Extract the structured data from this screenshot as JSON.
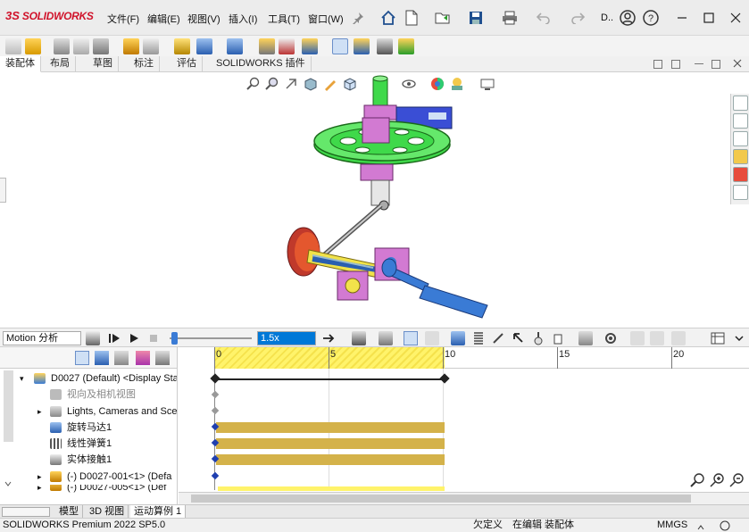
{
  "app": {
    "logo_ds": "3S",
    "logo_text": "SOLIDWORKS",
    "search_trunc": "D.."
  },
  "menu": {
    "items": [
      "文件(F)",
      "编辑(E)",
      "视图(V)",
      "插入(I)",
      "工具(T)",
      "窗口(W)"
    ]
  },
  "tabs": {
    "items": [
      "装配体",
      "布局",
      "草图",
      "标注",
      "评估",
      "SOLIDWORKS 插件"
    ]
  },
  "motion": {
    "study_type": "Motion 分析",
    "speed": "1.5x"
  },
  "timeline": {
    "ticks": [
      "0",
      "5",
      "10",
      "15",
      "20"
    ]
  },
  "tree": {
    "nodes": [
      {
        "label": "D0027 (Default) <Display Sta"
      },
      {
        "label": "视向及相机视图"
      },
      {
        "label": "Lights, Cameras and Sce"
      },
      {
        "label": "旋转马达1"
      },
      {
        "label": "线性弹簧1"
      },
      {
        "label": "实体接触1"
      },
      {
        "label": "(-) D0027-001<1> (Defa"
      },
      {
        "label": "(-) D0027-005<1> (Def"
      }
    ]
  },
  "bottom_tabs": {
    "items": [
      "模型",
      "3D 视图",
      "运动算例 1"
    ]
  },
  "status": {
    "product": "SOLIDWORKS Premium 2022 SP5.0",
    "custom": "欠定义",
    "editing": "在编辑 装配体",
    "units": "MMGS"
  },
  "colors": {
    "accent": "#d0122a",
    "timeline_yellow": "#fff36a",
    "bar_gold": "#d4b24a",
    "wheel_green": "#3fd94a",
    "part_magenta": "#d27ad2",
    "part_blue": "#3a7bd5"
  }
}
